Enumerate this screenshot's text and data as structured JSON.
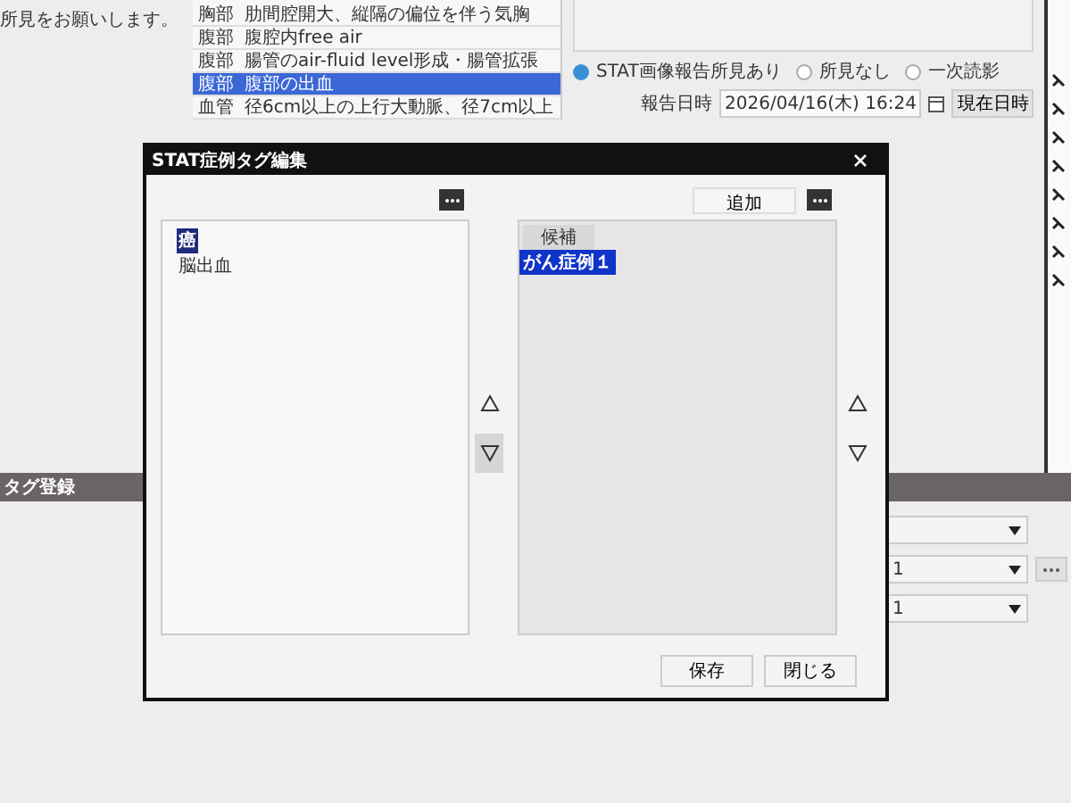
{
  "background": {
    "left_text": "所見をお願いします。",
    "findings": [
      {
        "category": "胸部",
        "text": "肋間腔開大、縦隔の偏位を伴う気胸",
        "selected": false
      },
      {
        "category": "腹部",
        "text": "腹腔内free air",
        "selected": false
      },
      {
        "category": "腹部",
        "text": "腸管のair-fluid level形成・腸管拡張",
        "selected": false
      },
      {
        "category": "腹部",
        "text": "腹部の出血",
        "selected": true
      },
      {
        "category": "血管",
        "text": "径6cm以上の上行大動脈、径7cm以上",
        "selected": false
      }
    ],
    "report_options": [
      {
        "label": "STAT画像報告所見あり",
        "selected": true
      },
      {
        "label": "所見なし",
        "selected": false
      },
      {
        "label": "一次読影",
        "selected": false
      }
    ],
    "report_date": {
      "label": "報告日時",
      "value": "2026/04/16(木) 16:24",
      "now_button": "現在日時"
    },
    "section_title": "タグ登録",
    "dropdowns": [
      {
        "more_button": false
      },
      {
        "value": "1",
        "more_button": true
      },
      {
        "value": "1",
        "more_button": false
      }
    ]
  },
  "dialog": {
    "title": "STAT症例タグ編集",
    "tags": [
      {
        "label": "癌",
        "selected": true
      },
      {
        "label": "脳出血",
        "selected": false
      }
    ],
    "add_button": "追加",
    "candidates": {
      "header": "候補",
      "items": [
        {
          "label": "がん症例１",
          "selected": true
        }
      ]
    },
    "buttons": [
      "保存",
      "閉じる"
    ]
  }
}
